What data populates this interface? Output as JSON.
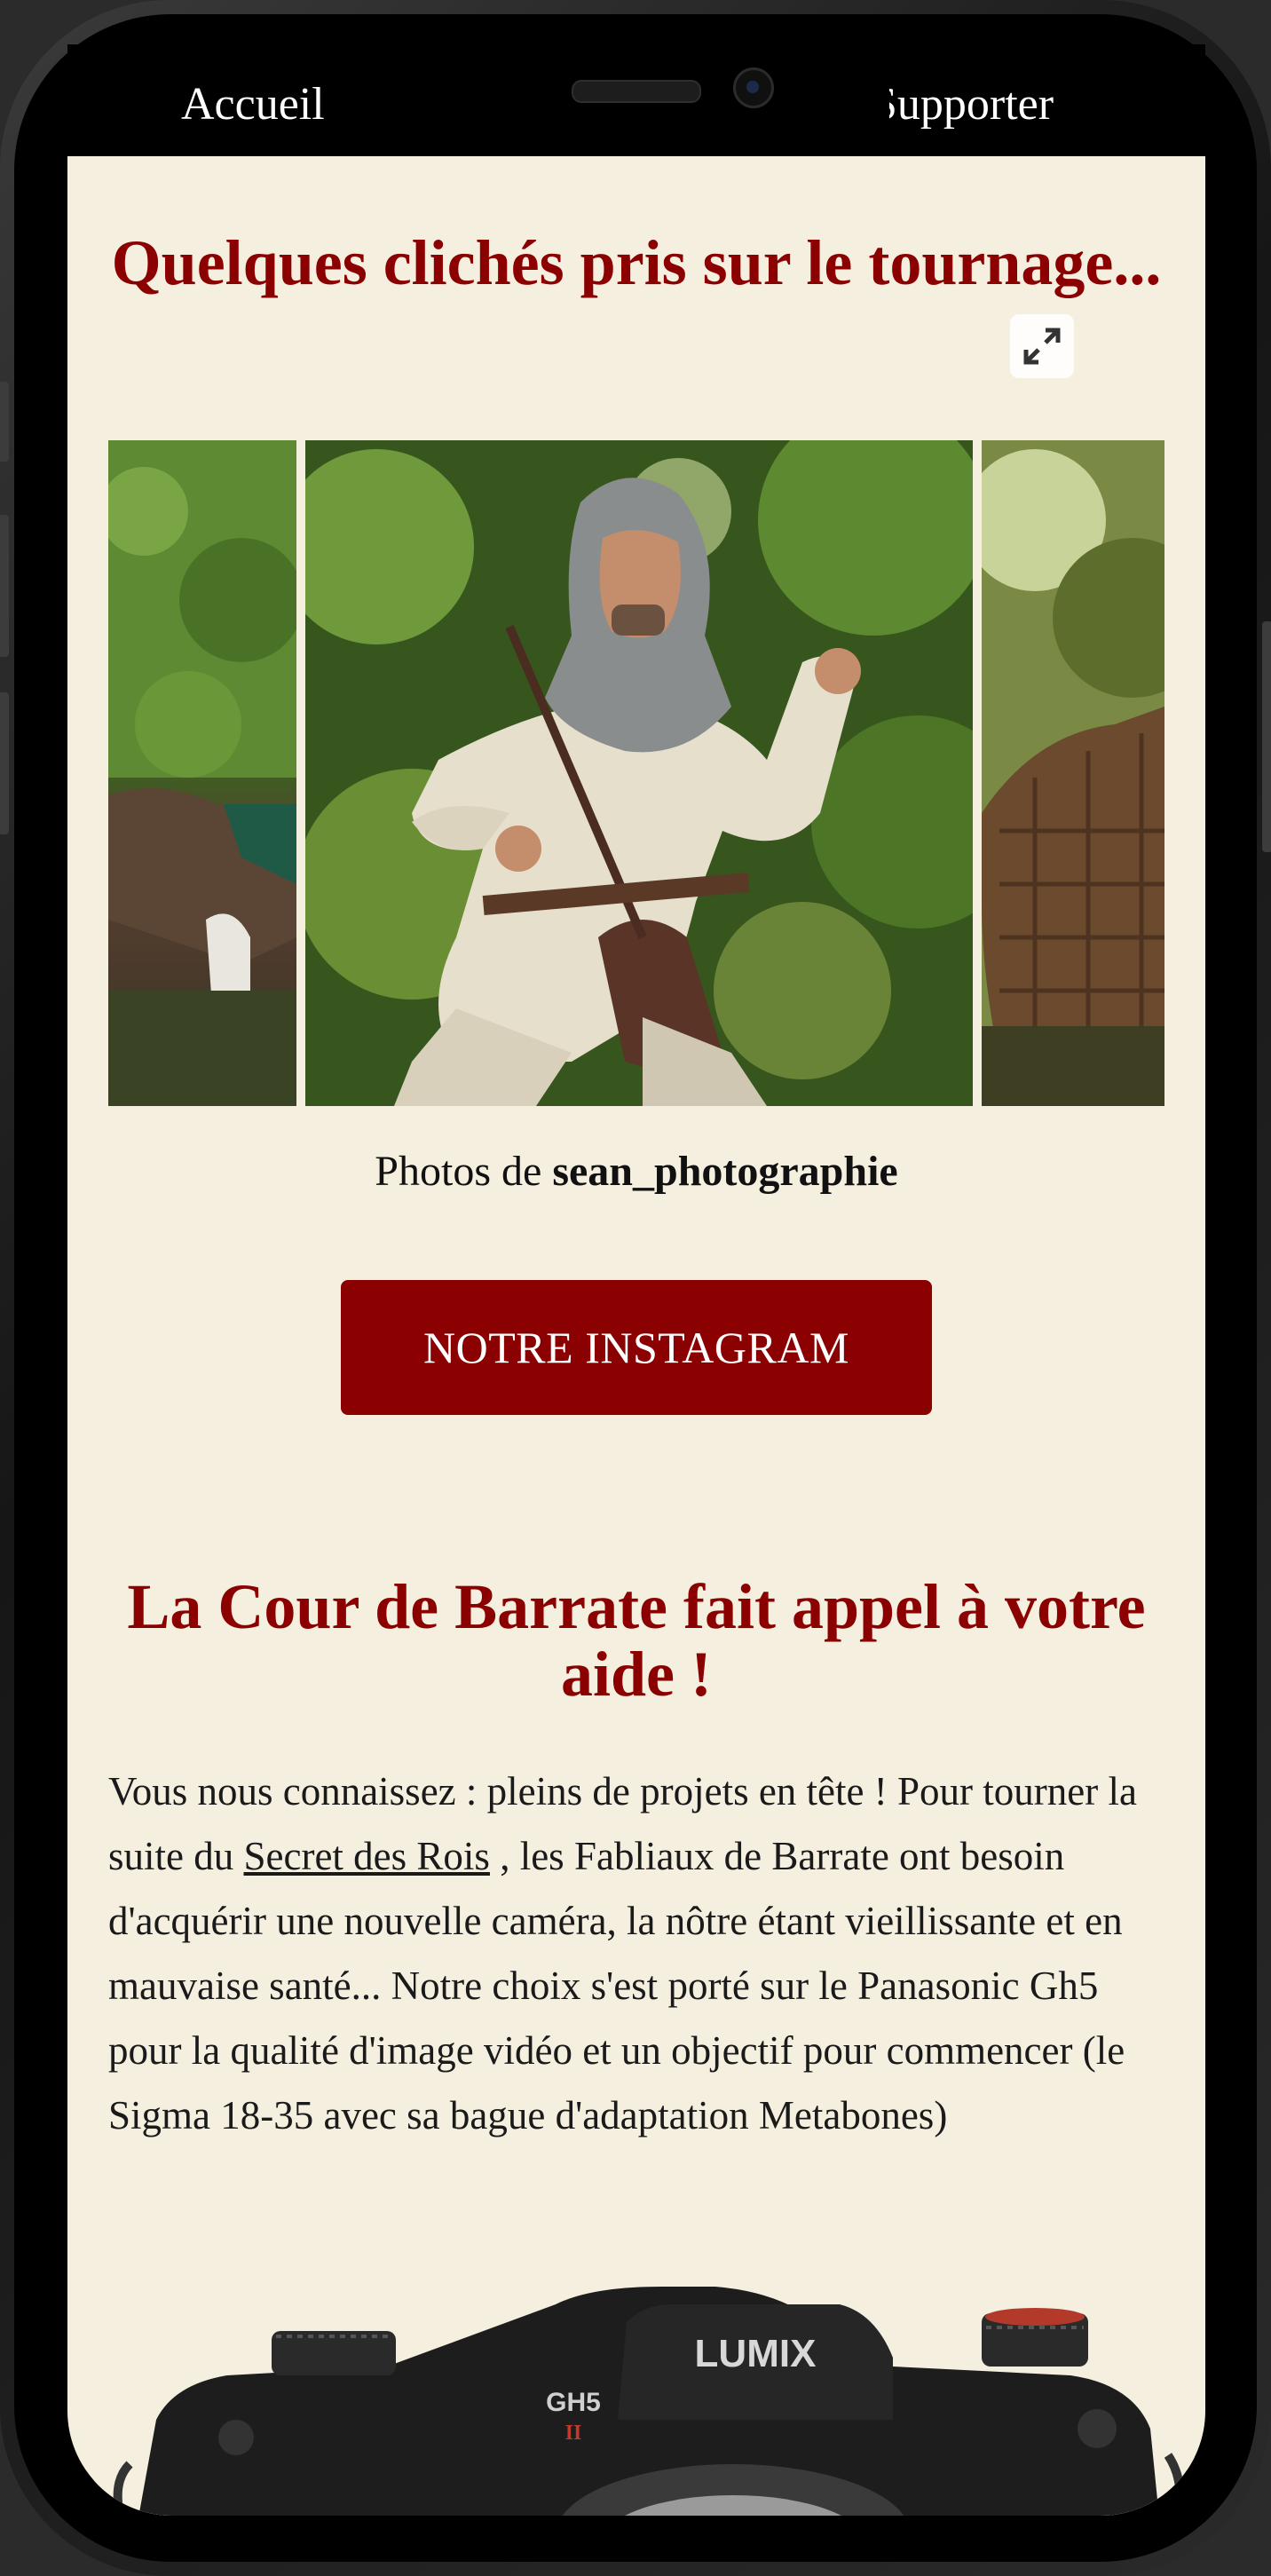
{
  "nav": {
    "left_label": "Accueil",
    "right_label": "Supporter"
  },
  "gallery": {
    "title": "Quelques clichés pris sur le tournage...",
    "credit_prefix": "Photos de",
    "credit_author": "sean_photographie",
    "instagram_button": "NOTRE INSTAGRAM"
  },
  "appeal": {
    "title": "La Cour de Barrate fait appel à votre aide !",
    "paragraph_before_link": "Vous nous connaissez : pleins de projets en tête ! Pour tourner la suite du ",
    "link_text": "Secret des Rois",
    "paragraph_after_link": " , les Fabliaux de Barrate ont besoin d'acquérir une nouvelle caméra, la nôtre étant vieillissante et en mauvaise santé... Notre choix s'est porté sur le Panasonic Gh5 pour la qualité d'image vidéo et un objectif pour commencer (le Sigma 18-35 avec sa bague d'adaptation Metabones)"
  },
  "camera": {
    "brand_text": "LUMIX",
    "model_text": "GH5",
    "model_suffix": "II"
  },
  "colors": {
    "accent": "#8b0000",
    "page_background": "#f5efe0"
  }
}
